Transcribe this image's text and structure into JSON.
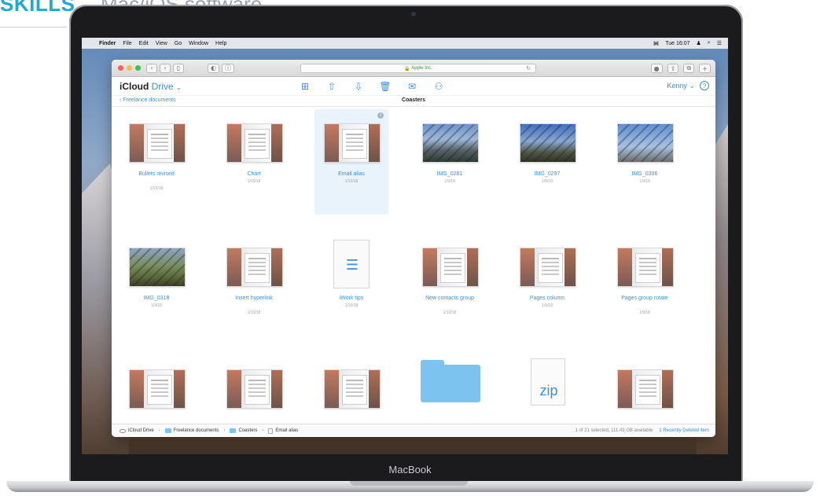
{
  "magazine": {
    "tag": "SKILLS",
    "title": "Mac/iOS software"
  },
  "laptop": {
    "brand": "MacBook"
  },
  "menubar": {
    "apple_icon": "apple-icon",
    "items": [
      "Finder",
      "File",
      "Edit",
      "View",
      "Go",
      "Window",
      "Help"
    ],
    "clock": "Tue 16:07"
  },
  "browser": {
    "url_label": "Apple Inc."
  },
  "app": {
    "brand": "iCloud",
    "section": "Drive",
    "user": "Kenny",
    "help": "?"
  },
  "path": {
    "back": "Freelance documents",
    "title": "Coasters"
  },
  "files": [
    {
      "name": "Bullets revised",
      "date": "1/23/18",
      "kind": "screenshot"
    },
    {
      "name": "Chart",
      "date": "1/10/18",
      "kind": "screenshot"
    },
    {
      "name": "Email alias",
      "date": "1/10/18",
      "kind": "screenshot",
      "selected": true
    },
    {
      "name": "IMG_0281",
      "date": "1/9/18",
      "kind": "photo-a"
    },
    {
      "name": "IMG_0297",
      "date": "1/9/18",
      "kind": "photo-b"
    },
    {
      "name": "IMG_0306",
      "date": "1/9/18",
      "kind": "photo-c"
    },
    {
      "name": "IMG_0318",
      "date": "1/9/18",
      "kind": "photo-d"
    },
    {
      "name": "Insert hyperlink",
      "date": "1/10/18",
      "kind": "screenshot"
    },
    {
      "name": "iWork tips",
      "date": "1/10/18",
      "kind": "doc"
    },
    {
      "name": "New contacts group",
      "date": "1/10/18",
      "kind": "screenshot"
    },
    {
      "name": "Pages column",
      "date": "1/9/18",
      "kind": "screenshot"
    },
    {
      "name": "Pages group rotate",
      "date": "1/9/18",
      "kind": "screenshot"
    },
    {
      "name": "",
      "date": "",
      "kind": "screenshot"
    },
    {
      "name": "",
      "date": "",
      "kind": "screenshot"
    },
    {
      "name": "",
      "date": "",
      "kind": "screenshot"
    },
    {
      "name": "",
      "date": "",
      "kind": "folder"
    },
    {
      "name": "",
      "date": "",
      "kind": "zip",
      "label": "zip"
    },
    {
      "name": "",
      "date": "",
      "kind": "screenshot"
    }
  ],
  "statusbar": {
    "crumbs": [
      "iCloud Drive",
      "Freelance documents",
      "Coasters",
      "Email alias"
    ],
    "selection": "1 of 21 selected, 111.43 GB available",
    "deleted": "1 Recently Deleted item"
  }
}
